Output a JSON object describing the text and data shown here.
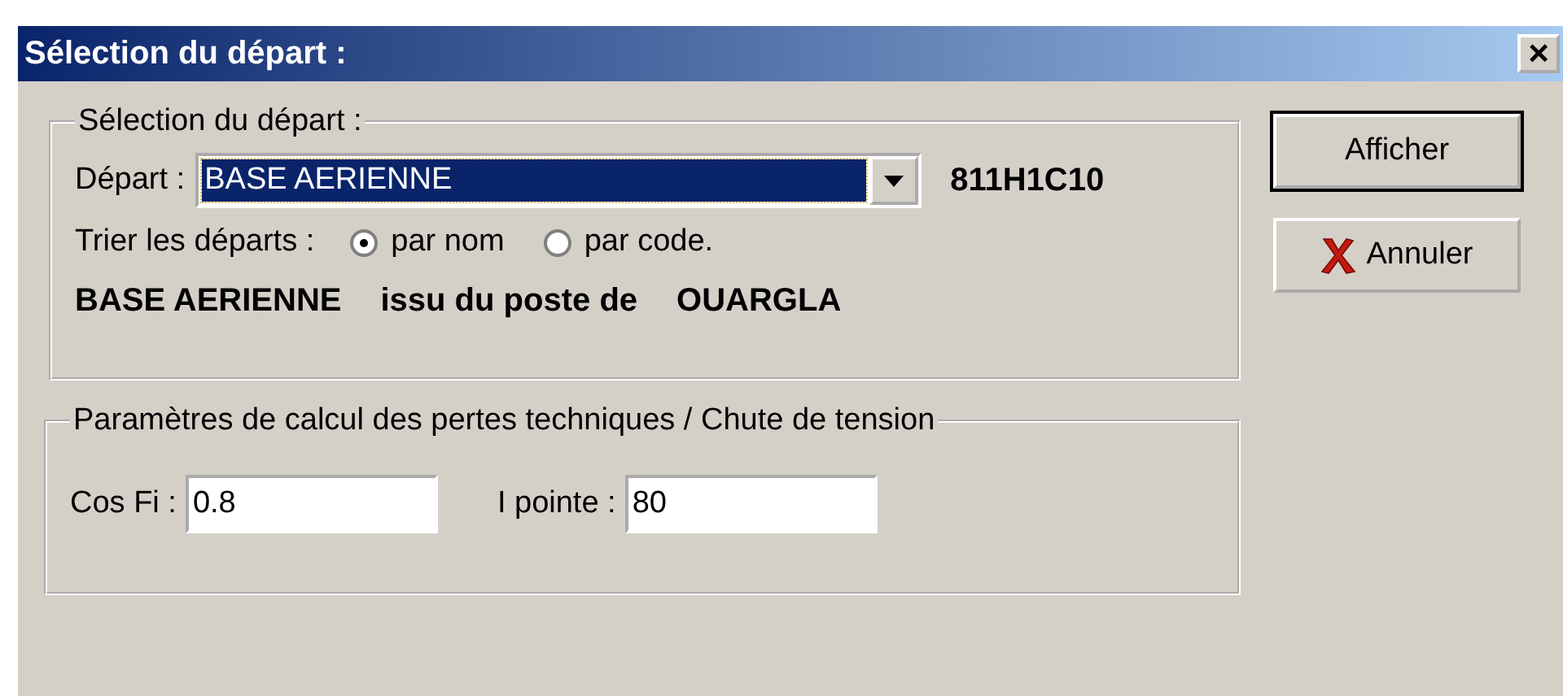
{
  "window": {
    "title": "Sélection du départ :",
    "close": "×"
  },
  "selection_group": {
    "legend": "Sélection du  départ :",
    "depart_label": "Départ :",
    "depart_value": "BASE AERIENNE",
    "code": "811H1C10",
    "sort_label": "Trier les départs :",
    "sort_options": [
      {
        "label": "par nom",
        "selected": true
      },
      {
        "label": "par code.",
        "selected": false
      }
    ],
    "summary_name": "BASE AERIENNE",
    "summary_text": "issu du poste de",
    "summary_poste": "OUARGLA"
  },
  "params_group": {
    "legend": "Paramètres de calcul des pertes techniques / Chute de tension",
    "fields": [
      {
        "label": "Cos Fi :",
        "value": "0.8"
      },
      {
        "label": "I pointe :",
        "value": "80"
      }
    ]
  },
  "buttons": [
    {
      "label": "Afficher",
      "kind": "default"
    },
    {
      "label": "Annuler",
      "kind": "cancel"
    }
  ]
}
